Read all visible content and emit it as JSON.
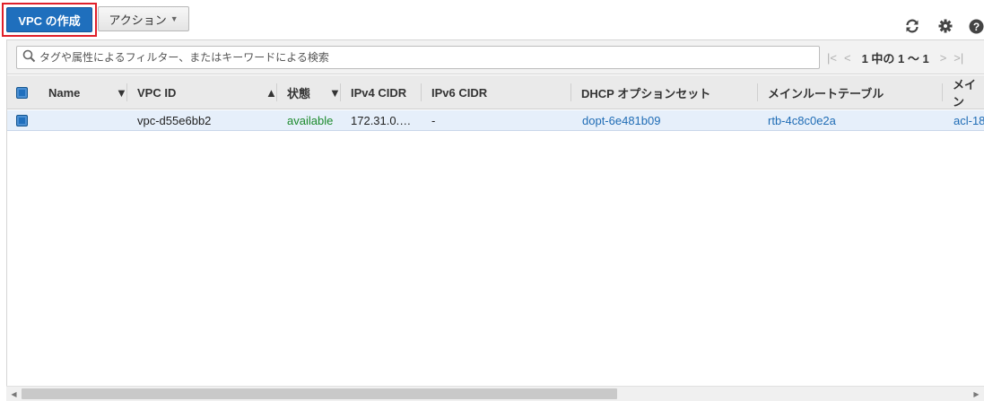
{
  "toolbar": {
    "create_vpc_label": "VPC の作成",
    "actions_label": "アクション",
    "icons": [
      "refresh-icon",
      "gear-icon",
      "help-icon"
    ]
  },
  "filter": {
    "placeholder": "タグや属性によるフィルター、またはキーワードによる検索"
  },
  "pager": {
    "text": "1 中の 1 ～ 1"
  },
  "table": {
    "columns": [
      "Name",
      "VPC ID",
      "状態",
      "IPv4 CIDR",
      "IPv6 CIDR",
      "DHCP オプションセット",
      "メインルートテーブル",
      "メイン"
    ],
    "rows": [
      {
        "name": "",
        "vpc_id": "vpc-d55e6bb2",
        "state": "available",
        "ipv4": "172.31.0.…",
        "ipv6": "-",
        "dhcp": "dopt-6e481b09",
        "route_table": "rtb-4c8c0e2a",
        "acl": "acl-18"
      }
    ]
  },
  "colors": {
    "primary_button": "#1f6fbd",
    "highlight_border": "#e0202a",
    "available_green": "#1c8a2c",
    "link_blue": "#1f6cb5",
    "selected_row": "#e6effa"
  }
}
